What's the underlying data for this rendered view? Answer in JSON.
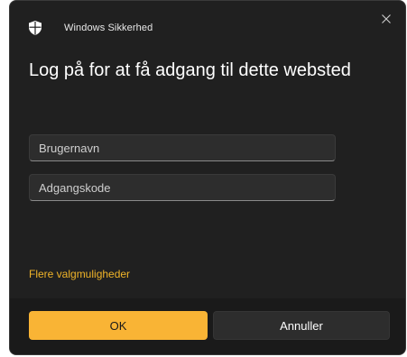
{
  "window": {
    "app_title": "Windows Sikkerhed",
    "close_icon": "close-icon",
    "app_icon": "shield-icon"
  },
  "dialog": {
    "heading": "Log på for at få adgang til dette websted",
    "username": {
      "value": "",
      "placeholder": "Brugernavn"
    },
    "password": {
      "value": "",
      "placeholder": "Adgangskode"
    },
    "more_options_label": "Flere valgmuligheder"
  },
  "footer": {
    "ok_label": "OK",
    "cancel_label": "Annuller"
  },
  "colors": {
    "background": "#202020",
    "accent": "#f9b435",
    "link": "#f0b429"
  }
}
